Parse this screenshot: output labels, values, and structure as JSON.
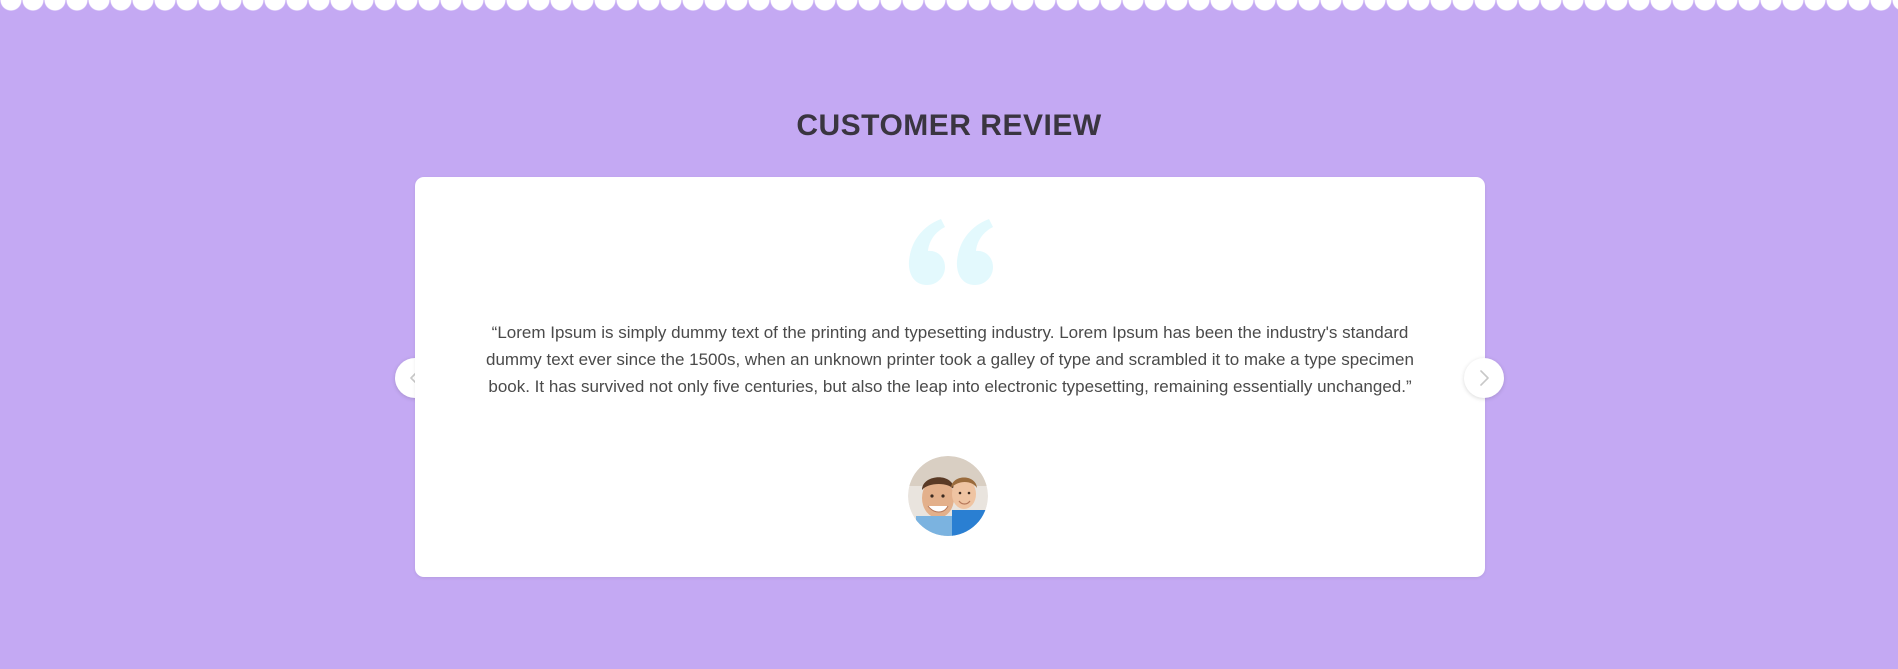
{
  "section": {
    "title": "CUSTOMER REVIEW",
    "background_color": "#c4a9f3"
  },
  "carousel": {
    "prev_icon": "chevron-left-icon",
    "next_icon": "chevron-right-icon"
  },
  "review": {
    "quote_icon": "quote-icon",
    "quote_color": "#e3f9fd",
    "text": "“Lorem Ipsum is simply dummy text of the printing and typesetting industry. Lorem Ipsum has been the industry's standard dummy text ever since the 1500s, when an unknown printer took a galley of type and scrambled it to make a type specimen book. It has survived not only five centuries, but also the leap into electronic typesetting, remaining essentially unchanged.”",
    "avatar": "customer-avatar"
  }
}
